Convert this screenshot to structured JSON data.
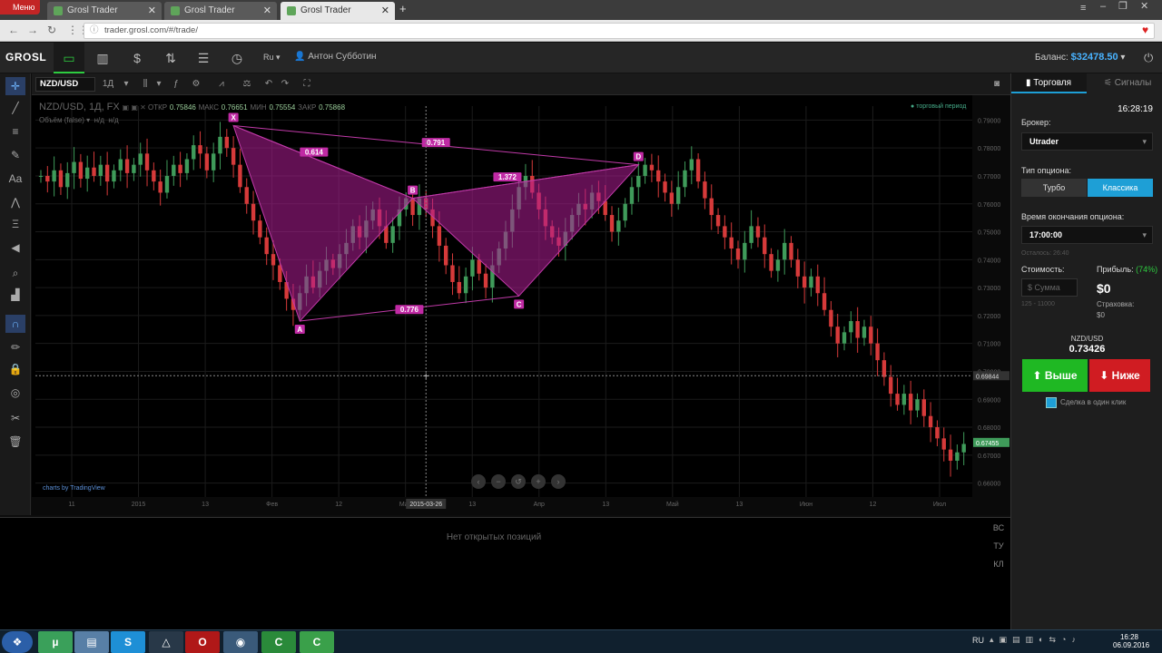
{
  "browser": {
    "menu_label": "Меню",
    "tabs": [
      {
        "label": "Grosl Trader"
      },
      {
        "label": "Grosl Trader"
      },
      {
        "label": "Grosl Trader"
      }
    ],
    "url": "trader.grosl.com/#/trade/"
  },
  "header": {
    "logo": "GROSL",
    "lang": "Ru ▾",
    "user": "Антон Субботин",
    "balance_label": "Баланс:",
    "balance_value": "$32478.50"
  },
  "chart_toolbar": {
    "symbol": "NZD/USD",
    "interval": "1Д"
  },
  "chart_info": {
    "title": "NZD/USD, 1Д, FX",
    "otkr_label": "ОТКР",
    "otkr": "0.75846",
    "maks_label": "МАКС",
    "maks": "0.76651",
    "min_label": "МИН",
    "min": "0.75554",
    "zakr_label": "ЗАКР",
    "zakr": "0.75868",
    "volume": "Объём (false)",
    "nd": "н/д",
    "trading_period": "торговый период",
    "credit": "charts by TradingView"
  },
  "chart_data": {
    "type": "candlestick",
    "symbol": "NZD/USD",
    "interval": "1Д",
    "x_ticks": [
      "11",
      "2015",
      "13",
      "Фев",
      "12",
      "Мар",
      "13",
      "Апр",
      "13",
      "Май",
      "13",
      "Июн",
      "12",
      "Июл"
    ],
    "y_ticks": [
      0.79,
      0.78,
      0.77,
      0.76,
      0.75,
      0.74,
      0.73,
      0.72,
      0.71,
      0.7,
      0.69,
      0.68,
      0.67,
      0.66
    ],
    "ylim": [
      0.655,
      0.795
    ],
    "crosshair_date": "2015-03-26",
    "crosshair_price": "0.69844",
    "last_price": "0.67455",
    "pattern": {
      "points": [
        {
          "label": "X",
          "price": 0.788
        },
        {
          "label": "A",
          "price": 0.718
        },
        {
          "label": "B",
          "price": 0.762
        },
        {
          "label": "C",
          "price": 0.727
        },
        {
          "label": "D",
          "price": 0.774
        }
      ],
      "ratios": [
        "0.614",
        "0.791",
        "1.372",
        "0.776"
      ]
    },
    "candles": [
      0.77,
      0.768,
      0.772,
      0.766,
      0.771,
      0.775,
      0.769,
      0.773,
      0.77,
      0.774,
      0.768,
      0.772,
      0.776,
      0.771,
      0.774,
      0.778,
      0.772,
      0.768,
      0.764,
      0.77,
      0.774,
      0.771,
      0.776,
      0.781,
      0.778,
      0.772,
      0.778,
      0.784,
      0.78,
      0.774,
      0.766,
      0.76,
      0.754,
      0.748,
      0.742,
      0.738,
      0.732,
      0.726,
      0.722,
      0.728,
      0.734,
      0.73,
      0.736,
      0.74,
      0.737,
      0.742,
      0.746,
      0.752,
      0.748,
      0.754,
      0.758,
      0.752,
      0.746,
      0.752,
      0.758,
      0.762,
      0.756,
      0.762,
      0.758,
      0.752,
      0.745,
      0.738,
      0.732,
      0.728,
      0.734,
      0.74,
      0.735,
      0.73,
      0.738,
      0.744,
      0.75,
      0.758,
      0.766,
      0.77,
      0.764,
      0.758,
      0.752,
      0.748,
      0.745,
      0.75,
      0.756,
      0.76,
      0.758,
      0.764,
      0.761,
      0.756,
      0.75,
      0.754,
      0.76,
      0.766,
      0.77,
      0.774,
      0.772,
      0.768,
      0.764,
      0.76,
      0.766,
      0.772,
      0.776,
      0.768,
      0.762,
      0.756,
      0.752,
      0.748,
      0.744,
      0.74,
      0.746,
      0.752,
      0.748,
      0.742,
      0.736,
      0.74,
      0.746,
      0.74,
      0.734,
      0.73,
      0.734,
      0.728,
      0.722,
      0.716,
      0.71,
      0.714,
      0.718,
      0.712,
      0.716,
      0.71,
      0.704,
      0.698,
      0.692,
      0.688,
      0.692,
      0.686,
      0.69,
      0.684,
      0.68,
      0.676,
      0.672,
      0.668,
      0.671,
      0.674
    ]
  },
  "bottom": {
    "no_positions": "Нет открытых позиций",
    "tabs": [
      "ВС",
      "ТУ",
      "КЛ"
    ]
  },
  "panel": {
    "tab_trading": "Торговля",
    "tab_signals": "Сигналы",
    "time": "16:28:19",
    "broker_label": "Брокер:",
    "broker": "Utrader",
    "option_type_label": "Тип опциона:",
    "type_turbo": "Турбо",
    "type_classic": "Классика",
    "expiry_label": "Время окончания опциона:",
    "expiry": "17:00:00",
    "remaining": "Осталось: 26:40",
    "cost_label": "Стоимость:",
    "amount_placeholder": "Сумма",
    "range": "125 - 11000",
    "profit_label": "Прибыль:",
    "profit_pct": "(74%)",
    "profit_value": "$0",
    "insurance_label": "Страховка:",
    "insurance_value": "$0",
    "pair": "NZD/USD",
    "price": "0.73426",
    "up_label": "Выше",
    "down_label": "Ниже",
    "oneclick": "Сделка в один клик",
    "colors": {
      "up": "#1fb823",
      "down": "#d01c22",
      "accent": "#1e9fd6",
      "balance": "#49b3ff"
    }
  },
  "taskbar": {
    "lang": "RU",
    "time": "16:28",
    "date": "06.09.2016"
  }
}
